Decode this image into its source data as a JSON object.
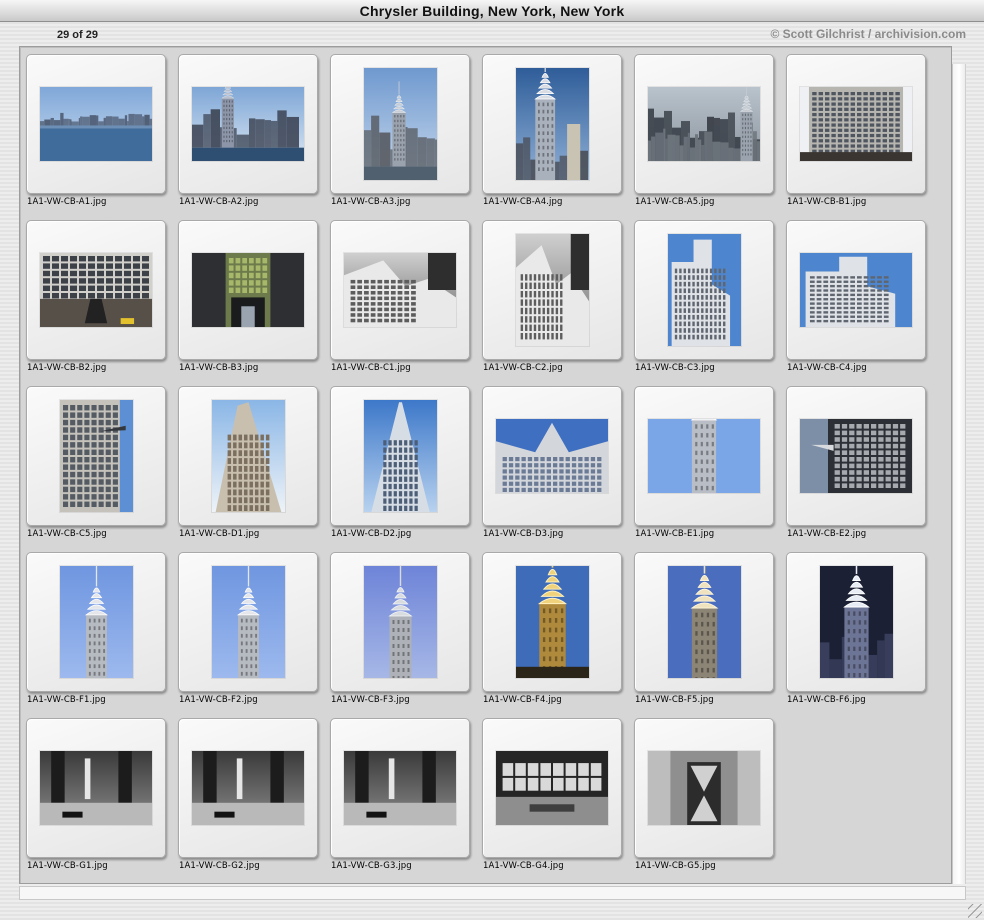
{
  "window": {
    "title": "Chrysler Building, New York, New York"
  },
  "header": {
    "count": "29 of 29",
    "credit": "© Scott Gilchrist / archivision.com"
  },
  "thumbnails": [
    {
      "name": "1A1-VW-CB-A1.jpg",
      "orientation": "landscape",
      "scene": "skyline-water"
    },
    {
      "name": "1A1-VW-CB-A2.jpg",
      "orientation": "landscape",
      "scene": "skyline-towers"
    },
    {
      "name": "1A1-VW-CB-A3.jpg",
      "orientation": "portrait",
      "scene": "skyline-spire"
    },
    {
      "name": "1A1-VW-CB-A4.jpg",
      "orientation": "portrait",
      "scene": "tower-spire"
    },
    {
      "name": "1A1-VW-CB-A5.jpg",
      "orientation": "landscape",
      "scene": "city-aerial"
    },
    {
      "name": "1A1-VW-CB-B1.jpg",
      "orientation": "landscape",
      "scene": "building-facade"
    },
    {
      "name": "1A1-VW-CB-B2.jpg",
      "orientation": "landscape",
      "scene": "street-facade"
    },
    {
      "name": "1A1-VW-CB-B3.jpg",
      "orientation": "landscape",
      "scene": "entrance"
    },
    {
      "name": "1A1-VW-CB-C1.jpg",
      "orientation": "landscape",
      "scene": "bw-setbacks"
    },
    {
      "name": "1A1-VW-CB-C2.jpg",
      "orientation": "portrait",
      "scene": "bw-setbacks"
    },
    {
      "name": "1A1-VW-CB-C3.jpg",
      "orientation": "portrait",
      "scene": "setbacks-sky"
    },
    {
      "name": "1A1-VW-CB-C4.jpg",
      "orientation": "landscape",
      "scene": "setbacks-sky"
    },
    {
      "name": "1A1-VW-CB-C5.jpg",
      "orientation": "portrait",
      "scene": "gargoyle-tower"
    },
    {
      "name": "1A1-VW-CB-D1.jpg",
      "orientation": "portrait",
      "scene": "tower-lookup"
    },
    {
      "name": "1A1-VW-CB-D2.jpg",
      "orientation": "portrait",
      "scene": "tower-lookup-blue"
    },
    {
      "name": "1A1-VW-CB-D3.jpg",
      "orientation": "landscape",
      "scene": "tower-lookup-wide"
    },
    {
      "name": "1A1-VW-CB-E1.jpg",
      "orientation": "landscape",
      "scene": "crown-top"
    },
    {
      "name": "1A1-VW-CB-E2.jpg",
      "orientation": "landscape",
      "scene": "gargoyle-dark"
    },
    {
      "name": "1A1-VW-CB-F1.jpg",
      "orientation": "portrait",
      "scene": "crown-spire"
    },
    {
      "name": "1A1-VW-CB-F2.jpg",
      "orientation": "portrait",
      "scene": "crown-spire"
    },
    {
      "name": "1A1-VW-CB-F3.jpg",
      "orientation": "portrait",
      "scene": "crown-spire-soft"
    },
    {
      "name": "1A1-VW-CB-F4.jpg",
      "orientation": "portrait",
      "scene": "crown-lit-gold"
    },
    {
      "name": "1A1-VW-CB-F5.jpg",
      "orientation": "portrait",
      "scene": "crown-lit-dusk"
    },
    {
      "name": "1A1-VW-CB-F6.jpg",
      "orientation": "portrait",
      "scene": "crown-night"
    },
    {
      "name": "1A1-VW-CB-G1.jpg",
      "orientation": "landscape",
      "scene": "lobby-bw"
    },
    {
      "name": "1A1-VW-CB-G2.jpg",
      "orientation": "landscape",
      "scene": "lobby-bw"
    },
    {
      "name": "1A1-VW-CB-G3.jpg",
      "orientation": "landscape",
      "scene": "lobby-bw"
    },
    {
      "name": "1A1-VW-CB-G4.jpg",
      "orientation": "landscape",
      "scene": "lobby-bw-light"
    },
    {
      "name": "1A1-VW-CB-G5.jpg",
      "orientation": "landscape",
      "scene": "elevator-door"
    }
  ]
}
